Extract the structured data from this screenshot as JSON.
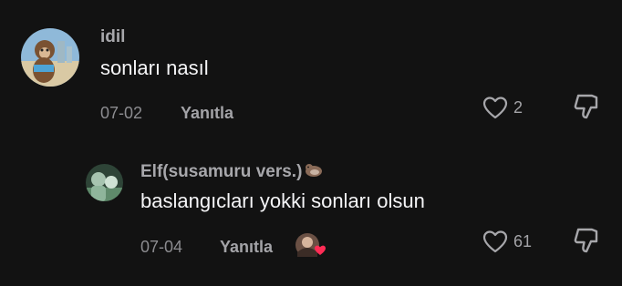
{
  "comments": [
    {
      "username": "idil",
      "text": "sonları nasıl",
      "date": "07-02",
      "reply_label": "Yanıtla",
      "likes": "2"
    },
    {
      "username": "Elf(susamuru vers.)",
      "text": "baslangıcları yokki sonları olsun",
      "date": "07-04",
      "reply_label": "Yanıtla",
      "likes": "61",
      "username_decoration_icon": "otter-emoji-icon",
      "badge_icon": "creator-liked-avatar-heart-icon"
    }
  ],
  "colors": {
    "background": "#121212",
    "text_primary": "#f5f5f7",
    "text_secondary": "#a7a7ab",
    "heart_badge": "#fe2c55"
  }
}
